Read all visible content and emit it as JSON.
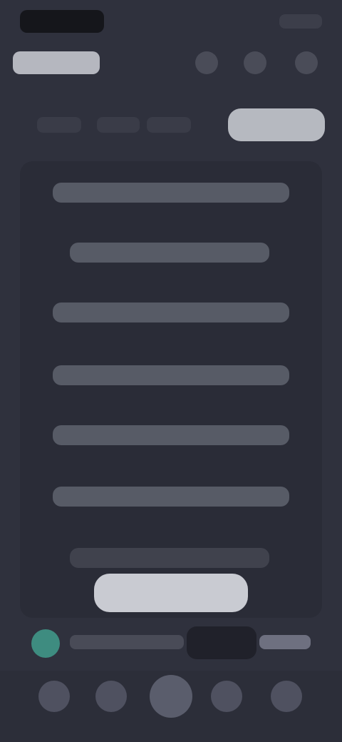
{
  "colors": {
    "background": "#2f313d",
    "card": "#2a2c37",
    "primary_button": "#c9cbd2",
    "avatar_accent": "#3e8c80"
  },
  "header": {
    "icons": [
      "icon-1",
      "icon-2",
      "icon-3"
    ]
  },
  "subbar": {
    "tabs": [
      "tab-1",
      "tab-2",
      "tab-3"
    ]
  },
  "card": {
    "lines": [
      "line-1",
      "line-2",
      "line-3",
      "line-4",
      "line-5",
      "line-6",
      "line-7"
    ]
  },
  "bottom_nav": {
    "items": [
      "nav-1",
      "nav-2",
      "nav-3",
      "nav-4",
      "nav-5"
    ]
  }
}
